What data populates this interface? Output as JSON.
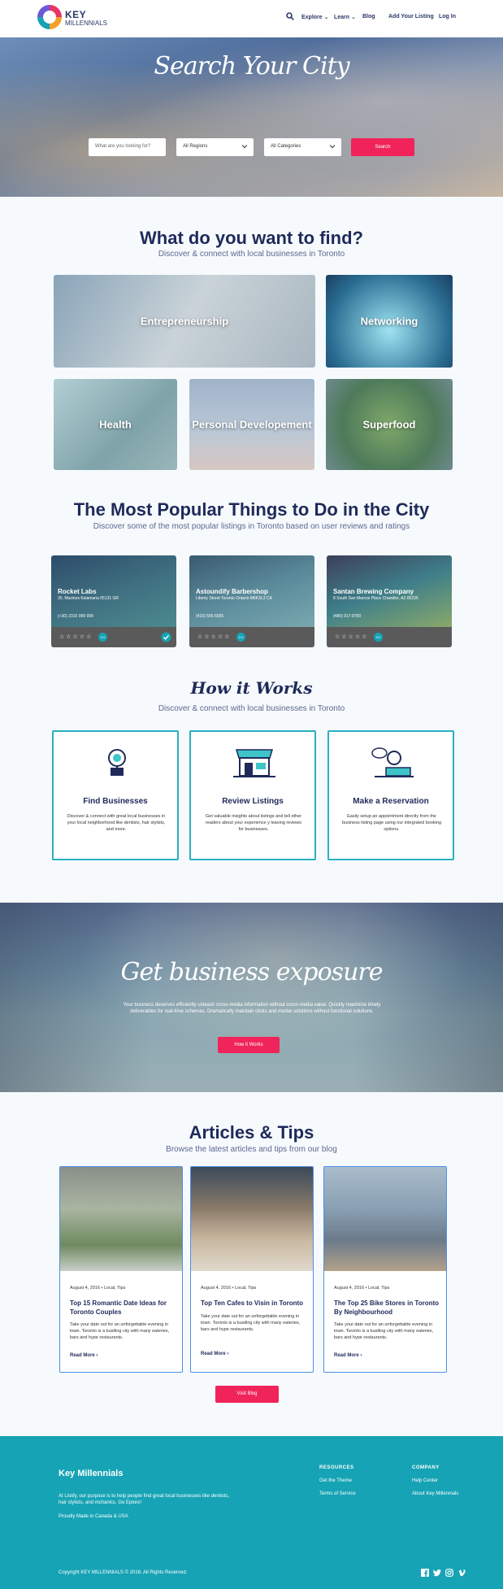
{
  "header": {
    "logo_main": "KEY",
    "logo_sub": "MILLENNIALS",
    "nav": {
      "explore": "Explore",
      "learn": "Learn",
      "blog": "Blog",
      "add_listing": "Add Your Listing",
      "login": "Log In"
    }
  },
  "hero": {
    "title": "Search Your City",
    "search_placeholder": "What are you looking for?",
    "region": "All Regions",
    "category": "All Categories",
    "search_button": "Search"
  },
  "find": {
    "title": "What do you want to find?",
    "subtitle": "Discover & connect with local businesses in Toronto",
    "categories": [
      "Entrepreneurship",
      "Networking",
      "Health",
      "Personal Developement",
      "Superfood"
    ]
  },
  "popular": {
    "title": "The Most Popular Things to Do in the City",
    "subtitle": "Discover some of the most popular listings in Toronto based on user reviews and ratings",
    "listings": [
      {
        "name": "Rocket Labs",
        "address": "30, Mazinos Kalamaria 55131 GR",
        "phone": "(+30) 2310 999 999",
        "stars": "☆☆☆☆☆",
        "badge": "0.0"
      },
      {
        "name": "Astoundify Barbershop",
        "address": "Liberty Street Toronto Ontario M6K3L3 CA",
        "phone": "(416) 555-5555",
        "stars": "☆☆☆☆☆",
        "badge": "0.0"
      },
      {
        "name": "Santan Brewing Company",
        "address": "8 South San Marcos Place Chandler, AZ 85225",
        "phone": "(480) 917-8700",
        "stars": "☆☆☆☆☆",
        "badge": "0.0"
      }
    ]
  },
  "how": {
    "title": "How it Works",
    "subtitle": "Discover & connect with local businesses in Toronto",
    "steps": [
      {
        "title": "Find Businesses",
        "text": "Discover & connect with great local businesses in your local neighborhood like dentists, hair stylists, and more."
      },
      {
        "title": "Review Listings",
        "text": "Get valuable insights about listings and tell other readers about your experience y leaving reviews for businesses."
      },
      {
        "title": "Make a Reservation",
        "text": "Easily setup an appointment directly from the business listing page using our integrated booking options."
      }
    ]
  },
  "exposure": {
    "title": "Get business exposure",
    "text": "Your business deserves efficiently unleash cross-media information without cross-media value. Quickly maximize timely deliverables for real-time schemas. Dramatically maintain clicks and mortar solutions without functional solutions.",
    "button": "How it Works"
  },
  "articles": {
    "title": "Articles & Tips",
    "subtitle": "Browse the latest articles and tips from our blog",
    "items": [
      {
        "date": "August 4, 2016 • Local, Tips",
        "title": "Top 15 Romantic Date Ideas for Toronto Couples",
        "text": "Take your date out for an unforgettable evening in town. Toronto is a bustling city with many eateries, bars and hype restaurants.",
        "more": "Read More"
      },
      {
        "date": "August 4, 2016 • Local, Tips",
        "title": "Top Ten Cafes to Visin in Toronto",
        "text": "Take your date out for an unforgettable evening in town. Toronto is a bustling city with many eateries, bars and hype restaurants.",
        "more": "Read More"
      },
      {
        "date": "August 4, 2016 • Local, Tips",
        "title": "The Top 25 Bike Stores in Toronto By Neighbourhood",
        "text": "Take your date out for an unforgettable evening in town. Toronto is a bustling city with many eateries, bars and hype restaurants.",
        "more": "Read More"
      }
    ],
    "visit_button": "Visit Blog"
  },
  "footer": {
    "brand": "Key Millennials",
    "about": "At Listify, our purpose is to help people find great local businesses like dentists, hair stylists, and mchanics. Go Eplore!",
    "made": "Proudly Made in Canada & USA",
    "resources_heading": "RESOURCES",
    "resources": [
      "Get the Theme",
      "Terms of Service"
    ],
    "company_heading": "COMPANY",
    "company": [
      "Help Center",
      "About Key Millennials"
    ],
    "copyright": "Copyright KEY MILLENNIALS © 2016. All Rights Reserved."
  },
  "colors": {
    "accent": "#f0245a",
    "teal": "#16a3b5",
    "navy": "#1f2a5a"
  }
}
